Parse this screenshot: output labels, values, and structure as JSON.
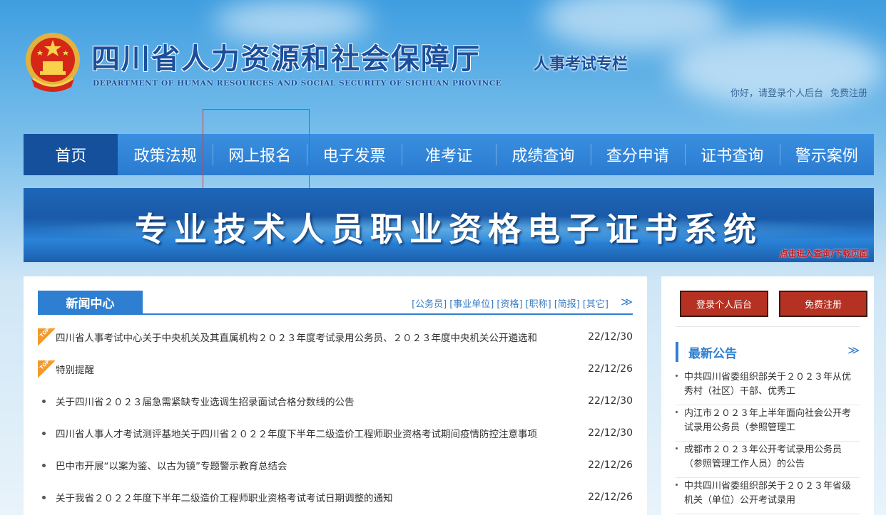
{
  "header": {
    "title": "四川省人力资源和社会保障厅",
    "subtitle": "DEPARTMENT OF HUMAN RESOURCES AND SOCIAL SECURITY OF SICHUAN PROVINCE",
    "column_title": "人事考试专栏",
    "greeting_link": "你好，请登录个人后台",
    "register_link": "免费注册"
  },
  "nav": {
    "items": [
      {
        "label": "首页",
        "active": true
      },
      {
        "label": "政策法规"
      },
      {
        "label": "网上报名"
      },
      {
        "label": "电子发票"
      },
      {
        "label": "准考证"
      },
      {
        "label": "成绩查询"
      },
      {
        "label": "查分申请"
      },
      {
        "label": "证书查询"
      },
      {
        "label": "警示案例"
      }
    ]
  },
  "banner": {
    "title": "专业技术人员职业资格电子证书系统",
    "link": "点击进入查询/下载页面"
  },
  "news": {
    "tab": "新闻中心",
    "categories": [
      "[公务员]",
      "[事业单位]",
      "[资格]",
      "[职称]",
      "[简报]",
      "[其它]"
    ],
    "more": "≫",
    "top_badge": "TOP",
    "items": [
      {
        "title": "四川省人事考试中心关于中央机关及其直属机构２０２３年度考试录用公务员、２０２３年度中央机关公开遴选和",
        "date": "22/12/30",
        "top": true
      },
      {
        "title": "特别提醒",
        "date": "22/12/26",
        "top": true
      },
      {
        "title": "关于四川省２０２３届急需紧缺专业选调生招录面试合格分数线的公告",
        "date": "22/12/30",
        "top": false
      },
      {
        "title": "四川省人事人才考试测评基地关于四川省２０２２年度下半年二级造价工程师职业资格考试期间疫情防控注意事项",
        "date": "22/12/30",
        "top": false
      },
      {
        "title": "巴中市开展“以案为鉴、以古为镜”专题警示教育总结会",
        "date": "22/12/26",
        "top": false
      },
      {
        "title": "关于我省２０２２年度下半年二级造价工程师职业资格考试考试日期调整的通知",
        "date": "22/12/26",
        "top": false
      }
    ]
  },
  "side": {
    "login_button": "登录个人后台",
    "register_button": "免费注册",
    "notice_title": "最新公告",
    "notice_more": "≫",
    "notices": [
      "中共四川省委组织部关于２０２３年从优秀村（社区）干部、优秀工",
      "内江市２０２３年上半年面向社会公开考试录用公务员（参照管理工",
      "成都市２０２３年公开考试录用公务员（参照管理工作人员）的公告",
      "中共四川省委组织部关于２０２３年省级机关（单位）公开考试录用"
    ]
  },
  "colors": {
    "nav_blue": "#2a7bd0",
    "nav_active": "#14509b",
    "accent_blue": "#2e7fd1",
    "button_red": "#b53122",
    "top_badge": "#f29a2e",
    "highlight_red": "#e23a3a"
  }
}
